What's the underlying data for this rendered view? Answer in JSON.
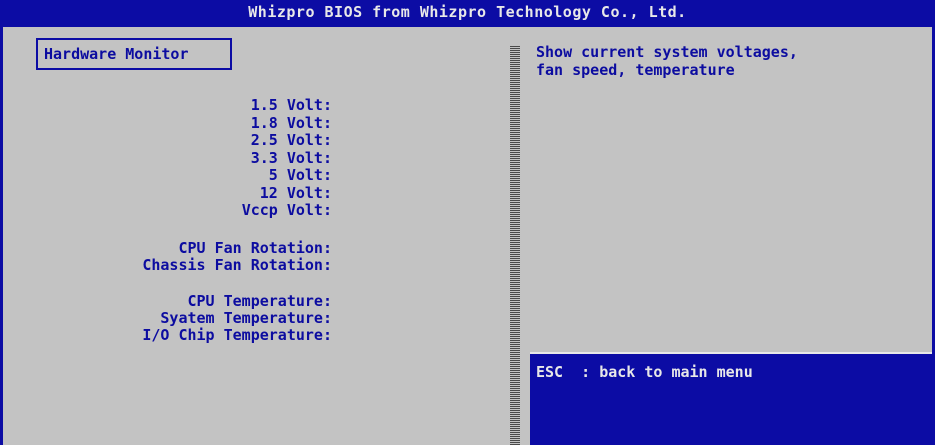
{
  "title": "Whizpro BIOS from Whizpro Technology Co., Ltd.",
  "section": "Hardware Monitor",
  "voltages": [
    "1.5 Volt:",
    "1.8 Volt:",
    "2.5 Volt:",
    "3.3 Volt:",
    "5 Volt:",
    "12 Volt:",
    "Vccp Volt:"
  ],
  "fans": [
    "CPU Fan Rotation:",
    "Chassis Fan Rotation:"
  ],
  "temps": [
    "CPU Temperature:",
    "Syatem Temperature:",
    "I/O Chip Temperature:"
  ],
  "help": [
    "Show current system voltages,",
    "fan speed, temperature"
  ],
  "status": {
    "key": "ESC",
    "text": "  : back to main menu"
  },
  "colors": {
    "bios_blue": "#0c0ca4",
    "bios_gray": "#c3c3c3",
    "text_white": "#e8e8e8"
  }
}
